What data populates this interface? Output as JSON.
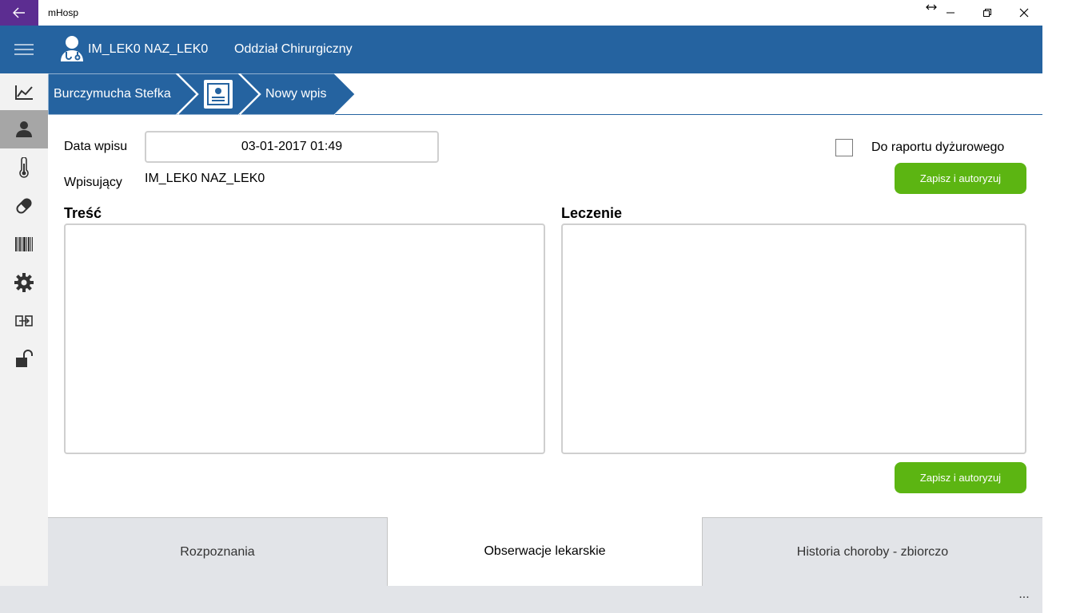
{
  "window": {
    "title": "mHosp"
  },
  "header": {
    "user_name": "IM_LEK0 NAZ_LEK0",
    "department": "Oddział Chirurgiczny"
  },
  "breadcrumb": {
    "patient": "Burczymucha Stefka",
    "current": "Nowy wpis"
  },
  "form": {
    "date_label": "Data wpisu",
    "date_value": "03-01-2017 01:49",
    "author_label": "Wpisujący",
    "author_value": "IM_LEK0 NAZ_LEK0",
    "report_checkbox_label": "Do raportu dyżurowego",
    "report_checked": false,
    "save_button_top": "Zapisz i autoryzuj",
    "save_button_bottom": "Zapisz i autoryzuj",
    "content_title": "Treść",
    "treatment_title": "Leczenie",
    "content_value": "",
    "treatment_value": ""
  },
  "tabs": [
    {
      "label": "Rozpoznania",
      "active": false
    },
    {
      "label": "Obserwacje lekarskie",
      "active": true
    },
    {
      "label": "Historia choroby - zbiorczo",
      "active": false
    }
  ],
  "appbar": {
    "more_label": "..."
  },
  "rail": {
    "items": [
      "chart-icon",
      "patient-icon",
      "thermometer-icon",
      "pill-icon",
      "barcode-icon",
      "gear-icon",
      "transfer-icon",
      "unlock-icon"
    ],
    "active_index": 1
  },
  "colors": {
    "brand": "#2563a0",
    "accent_green": "#5cb512",
    "back_button": "#5c2d91"
  }
}
